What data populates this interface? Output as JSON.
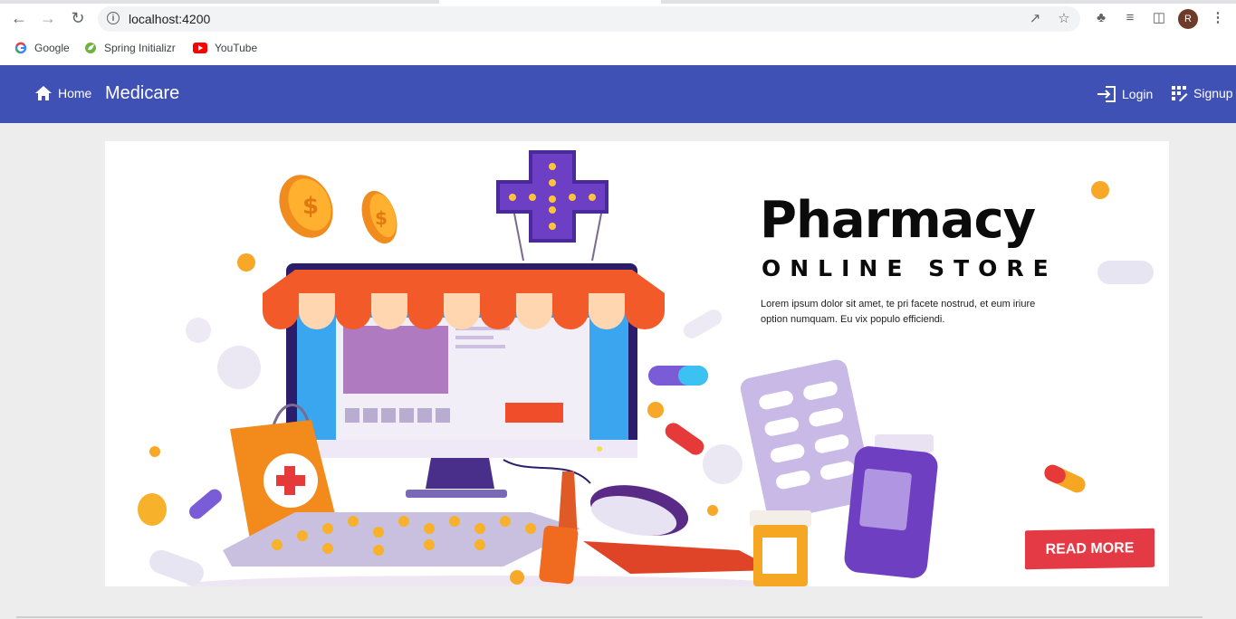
{
  "browser": {
    "url": "localhost:4200",
    "profile_initial": "R",
    "bookmarks": [
      {
        "label": "Google",
        "icon": "google-icon"
      },
      {
        "label": "Spring Initializr",
        "icon": "spring-icon"
      },
      {
        "label": "YouTube",
        "icon": "youtube-icon"
      }
    ]
  },
  "navbar": {
    "home_label": "Home",
    "brand": "Medicare",
    "login_label": "Login",
    "signup_label": "Signup",
    "color": "#3f51b5"
  },
  "banner": {
    "headline": "Pharmacy",
    "subhead": "ONLINE STORE",
    "body": "Lorem ipsum dolor sit amet, te pri facete nostrud, et eum iriure option numquam. Eu vix populo efficiendi.",
    "cta": "READ MORE",
    "cta_color": "#e43a45"
  }
}
